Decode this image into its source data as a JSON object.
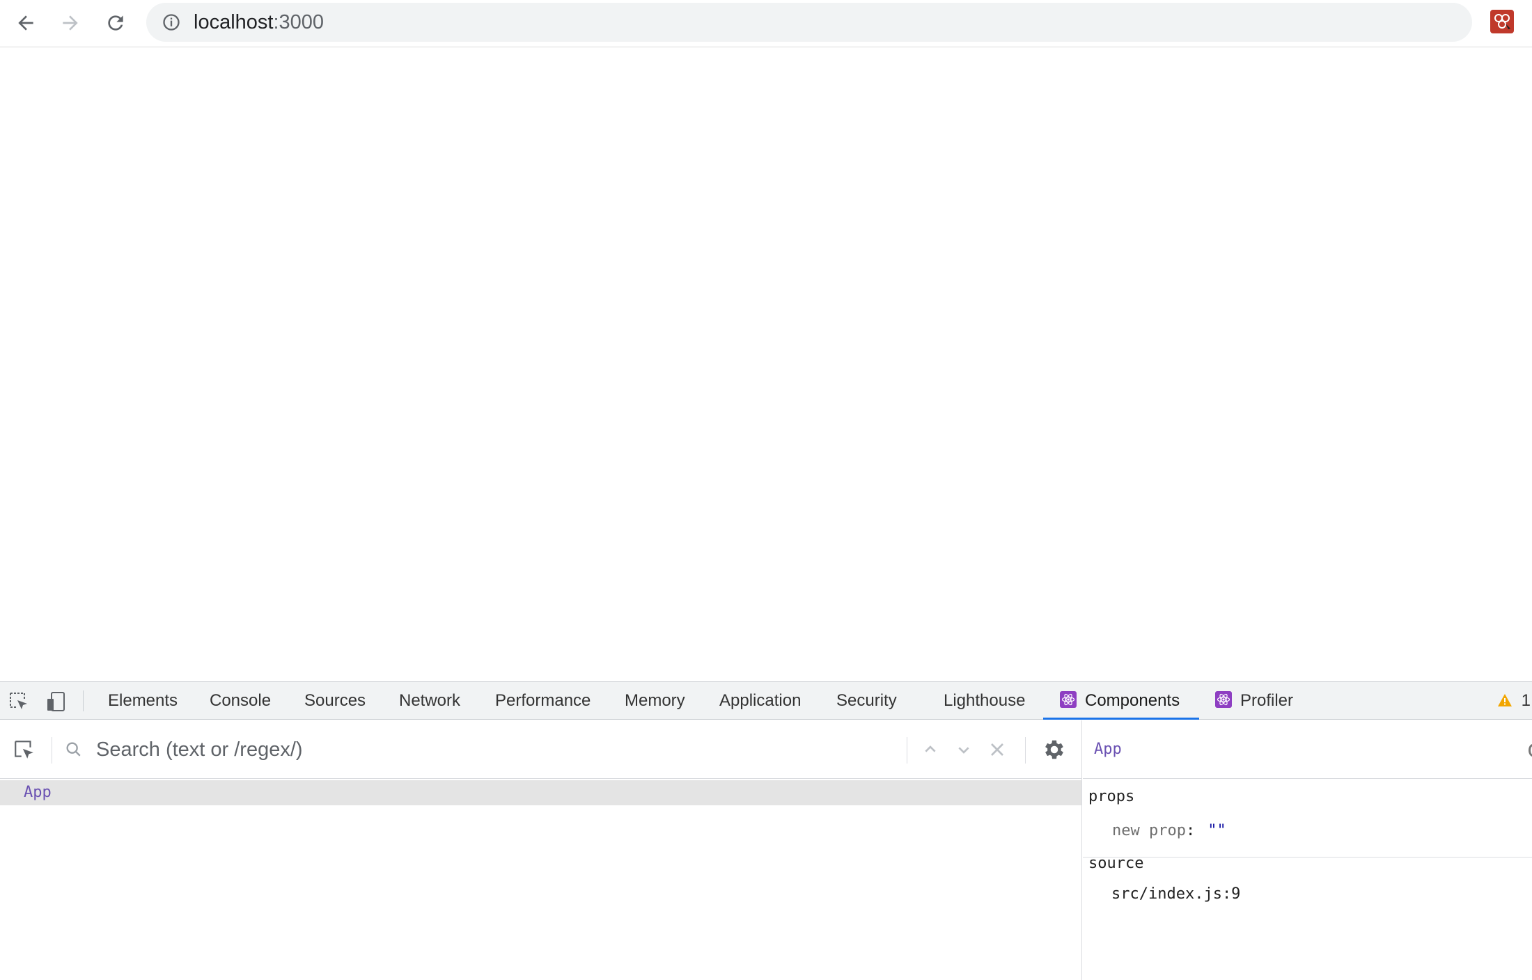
{
  "browser": {
    "url_host": "localhost",
    "url_port": ":3000",
    "icons": {
      "back": "back-arrow-icon",
      "forward": "forward-arrow-icon",
      "reload": "reload-icon",
      "info": "info-icon",
      "bookmark": "star-icon",
      "extension": "extension-icon"
    }
  },
  "devtools": {
    "tabs": [
      {
        "label": "Elements"
      },
      {
        "label": "Console"
      },
      {
        "label": "Sources"
      },
      {
        "label": "Network"
      },
      {
        "label": "Performance"
      },
      {
        "label": "Memory"
      },
      {
        "label": "Application"
      },
      {
        "label": "Security"
      },
      {
        "label": "Lighthouse"
      },
      {
        "label": "Components",
        "icon": "react-icon",
        "active": true
      },
      {
        "label": "Profiler",
        "icon": "react-icon"
      }
    ],
    "warning_count": "1",
    "accent_color": "#1a73e8"
  },
  "components": {
    "search_placeholder": "Search (text or /regex/)",
    "tree": [
      {
        "name": "App",
        "selected": true
      }
    ],
    "inspector": {
      "selected_name": "App",
      "props_title": "props",
      "props": [
        {
          "key": "new prop",
          "value": "\"\""
        }
      ],
      "source_title": "source",
      "source_file": "src/index.js:9"
    }
  }
}
